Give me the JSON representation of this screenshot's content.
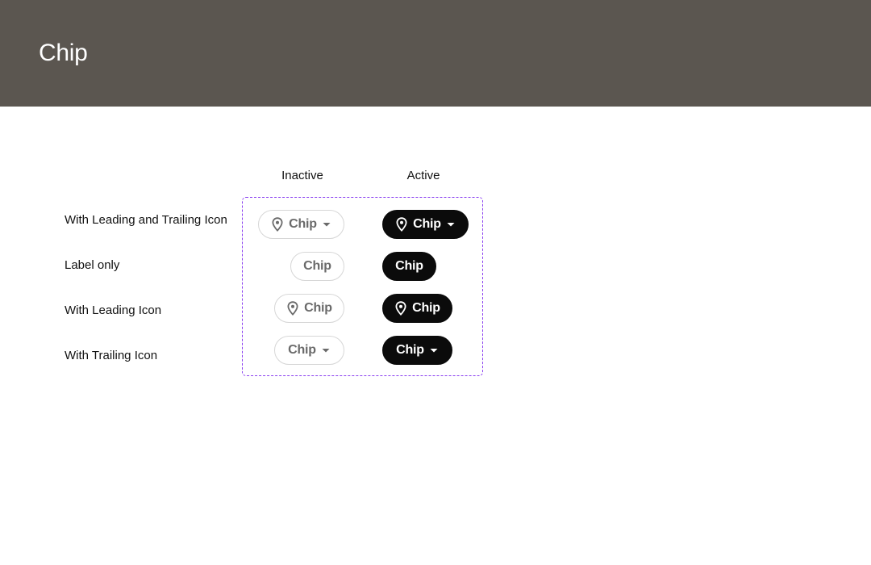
{
  "header": {
    "title": "Chip"
  },
  "columns": {
    "inactive": "Inactive",
    "active": "Active"
  },
  "rows": [
    {
      "label": "With Leading and Trailing Icon",
      "chip_label": "Chip",
      "leading_icon": "location-pin-icon",
      "trailing_icon": "caret-down-icon"
    },
    {
      "label": "Label only",
      "chip_label": "Chip"
    },
    {
      "label": "With Leading Icon",
      "chip_label": "Chip",
      "leading_icon": "location-pin-icon"
    },
    {
      "label": "With Trailing Icon",
      "chip_label": "Chip",
      "trailing_icon": "caret-down-icon"
    }
  ],
  "colors": {
    "header_bg": "#5b5650",
    "frame_border": "#8a3ff0",
    "active_bg": "#0b0b0b",
    "inactive_border": "#d6d6d6",
    "inactive_text": "#6a6a6a"
  }
}
